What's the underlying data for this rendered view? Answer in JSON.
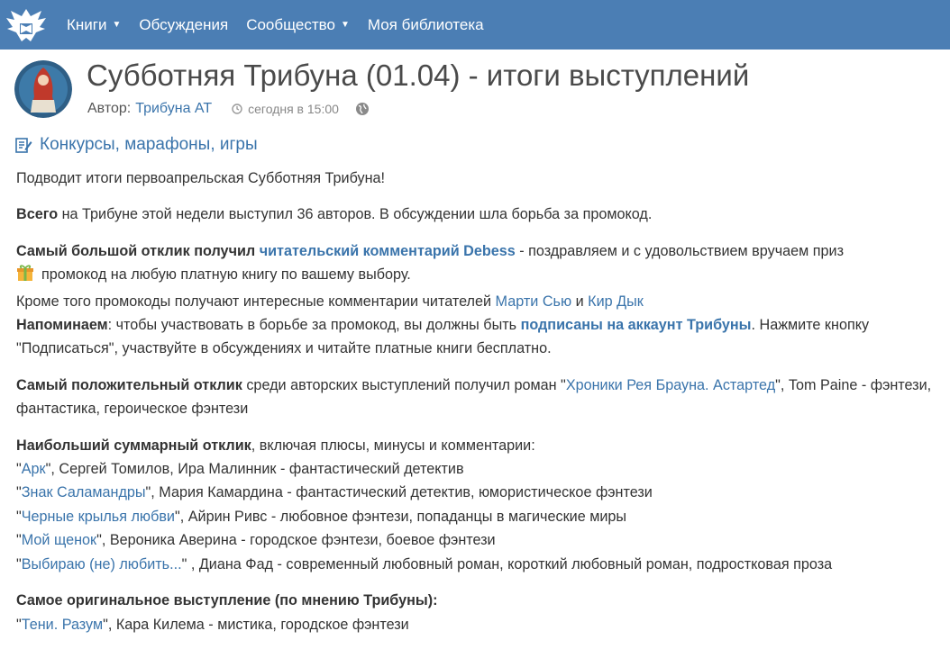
{
  "nav": {
    "books": "Книги",
    "discussions": "Обсуждения",
    "community": "Сообщество",
    "library": "Моя библиотека"
  },
  "post": {
    "title": "Субботняя Трибуна (01.04) - итоги выступлений",
    "author_prefix": "Автор:",
    "author": "Трибуна АТ",
    "time": "сегодня в 15:00",
    "category": "Конкурсы, марафоны, игры"
  },
  "body": {
    "intro": "Подводит итоги первоапрельская Субботняя Трибуна!",
    "p2_bold": "Всего",
    "p2_rest": " на Трибуне этой недели выступил 36 авторов. В обсуждении шла борьба за промокод.",
    "p3_bold": "Самый большой отклик получил ",
    "p3_link": "читательский комментарий Debess",
    "p3_rest": " - поздравляем и с удовольствием вручаем приз",
    "p3_line2": "промокод на любую платную книгу по вашему выбору.",
    "p3_line3": "Кроме того промокоды получают интересные комментарии читателей ",
    "p3_link2": "Марти Сью",
    "p3_and": " и ",
    "p3_link3": "Кир Дык",
    "p3_remind_bold": "Напоминаем",
    "p3_remind": ": чтобы участвовать в борьбе за промокод, вы должны быть ",
    "p3_remind_link": "подписаны на аккаунт Трибуны",
    "p3_remind_end": ". Нажмите кнопку \"Подписаться\", участвуйте в обсуждениях и читайте платные книги бесплатно.",
    "p4_bold": "Самый положительный отклик",
    "p4_mid": " среди авторских выступлений получил роман \"",
    "p4_link": "Хроники Рея Брауна. Астартед",
    "p4_end": "\", Tom Paine - фэнтези, фантастика, героическое фэнтези",
    "p5_bold": "Наибольший суммарный отклик",
    "p5_rest": ", включая плюсы, минусы и комментарии:",
    "list": [
      {
        "title": "Арк",
        "rest": "\", Сергей Томилов, Ира Малинник - фантастический детектив"
      },
      {
        "title": "Знак Саламандры",
        "rest": "\", Мария Камардина - фантастический детектив, юмористическое фэнтези"
      },
      {
        "title": "Черные крылья любви",
        "rest": "\", Айрин Ривс - любовное фэнтези, попаданцы в магические миры"
      },
      {
        "title": "Мой щенок",
        "rest": "\", Вероника Аверина - городское фэнтези, боевое фэнтези"
      },
      {
        "title": "Выбираю (не) любить...",
        "rest": "\" , Диана Фад - современный любовный роман, короткий любовный роман, подростковая проза"
      }
    ],
    "p6_bold": "Самое оригинальное выступление (по мнению Трибуны):",
    "p6_link": "Тени. Разум",
    "p6_rest": "\", Кара Килема - мистика, городское фэнтези"
  }
}
